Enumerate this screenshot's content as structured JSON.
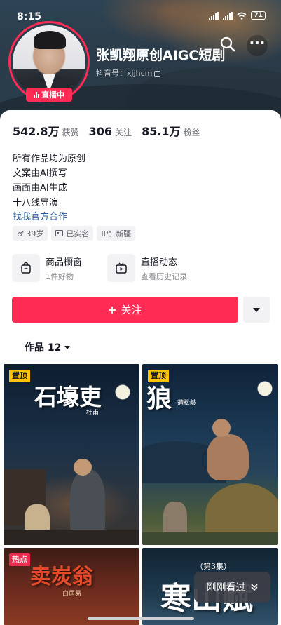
{
  "status_bar": {
    "time": "8:15",
    "battery": "71"
  },
  "profile": {
    "name": "张凯翔原创AIGC短剧",
    "douyin_id": "抖音号：xjjhcm",
    "live_badge": "直播中"
  },
  "stats": [
    {
      "value": "542.8万",
      "label": "获赞"
    },
    {
      "value": "306",
      "label": "关注"
    },
    {
      "value": "85.1万",
      "label": "粉丝"
    }
  ],
  "bio": {
    "lines": [
      "所有作品均为原创",
      "文案由AI撰写",
      "画面由AI生成",
      "十八线导演"
    ],
    "link": "找我官方合作"
  },
  "tags": [
    {
      "icon": "male-icon",
      "text": "♂ 39岁"
    },
    {
      "icon": "id-card-icon",
      "text": "已实名"
    },
    {
      "icon": "none",
      "text": "IP：新疆"
    }
  ],
  "services": [
    {
      "icon": "shop-bag-icon",
      "title": "商品橱窗",
      "subtitle": "1件好物"
    },
    {
      "icon": "live-tv-icon",
      "title": "直播动态",
      "subtitle": "查看历史记录"
    }
  ],
  "actions": {
    "follow": "关注"
  },
  "works_tab": {
    "label": "作品 12"
  },
  "videos": [
    {
      "badge": "置顶",
      "title": "石壕吏",
      "subtitle": "杜甫"
    },
    {
      "badge": "置顶",
      "title": "狼",
      "subtitle": "蒲松龄"
    },
    {
      "badge": "热点",
      "title": "卖炭翁",
      "subtitle": "白居易"
    },
    {
      "badge": "",
      "title": "寒山赋",
      "subtitle": "（第3集）"
    }
  ],
  "recent_pill": {
    "label": "刚刚看过"
  },
  "colors": {
    "accent": "#fe2c55",
    "pin": "#fec400",
    "link": "#2b5a9b"
  }
}
